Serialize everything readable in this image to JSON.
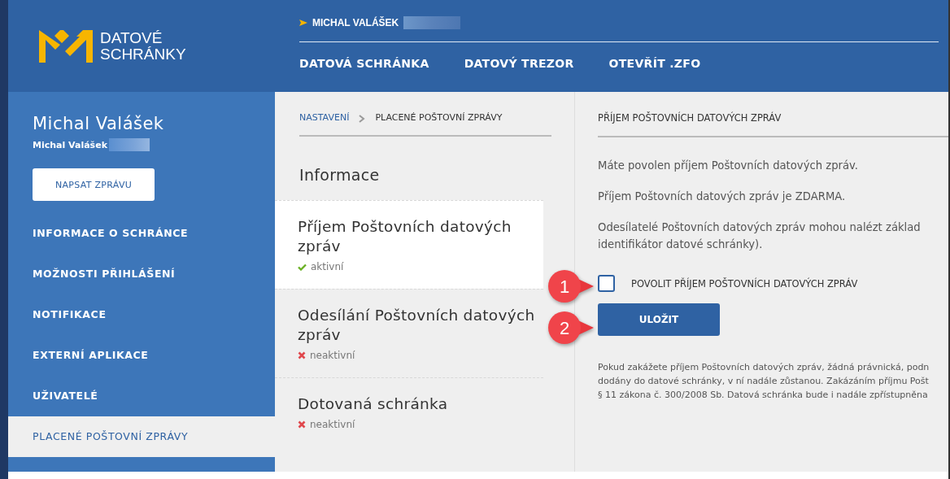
{
  "header": {
    "logo_text": [
      "DATOVÉ",
      "SCHRÁNKY"
    ],
    "user": "MICHAL VALÁŠEK",
    "nav": [
      "DATOVÁ SCHRÁNKA",
      "DATOVÝ TREZOR",
      "OTEVŘÍT .ZFO"
    ]
  },
  "sidebar": {
    "name": "Michal Valášek",
    "subname": "Michal Valášek",
    "compose_button": "NAPSAT ZPRÁVU",
    "items": [
      {
        "label": "INFORMACE O SCHRÁNCE",
        "selected": false
      },
      {
        "label": "MOŽNOSTI PŘIHLÁŠENÍ",
        "selected": false
      },
      {
        "label": "NOTIFIKACE",
        "selected": false
      },
      {
        "label": "EXTERNÍ APLIKACE",
        "selected": false
      },
      {
        "label": "UŽIVATELÉ",
        "selected": false
      },
      {
        "label": "PLACENÉ POŠTOVNÍ ZPRÁVY",
        "selected": true
      }
    ]
  },
  "breadcrumb": [
    "NASTAVENÍ",
    "PLACENÉ POŠTOVNÍ ZPRÁVY"
  ],
  "info": {
    "title": "Informace",
    "items": [
      {
        "title": "Příjem Poštovních datových zpráv",
        "status": "aktivní",
        "active": true,
        "selected": true
      },
      {
        "title": "Odesílání Poštovních datových zpráv",
        "status": "neaktivní",
        "active": false,
        "selected": false
      },
      {
        "title": "Dotovaná schránka",
        "status": "neaktivní",
        "active": false,
        "selected": false
      }
    ]
  },
  "detail": {
    "heading": "PŘÍJEM POŠTOVNÍCH DATOVÝCH ZPRÁV",
    "paragraphs": [
      [
        "Máte povolen příjem Poštovních datových zpráv."
      ],
      [
        "Příjem Poštovních datových zpráv je ZDARMA."
      ],
      [
        "Odesílatelé Poštovních datových zpráv mohou nalézt základ",
        "identifikátor datové schránky)."
      ]
    ],
    "checkbox": {
      "label": "POVOLIT PŘÍJEM POŠTOVNÍCH DATOVÝCH ZPRÁV",
      "checked": false
    },
    "save_button": "ULOŽIT",
    "note_lines": [
      "Pokud zakážete příjem Poštovních datových zpráv, žádná právnická, podn",
      "dodány do datové schránky, v ní nadále zůstanou. Zakázáním příjmu Pošt",
      "§ 11 zákona č. 300/2008 Sb. Datová schránka bude i nadále zpřístupněna"
    ]
  },
  "callouts": [
    "1",
    "2"
  ]
}
